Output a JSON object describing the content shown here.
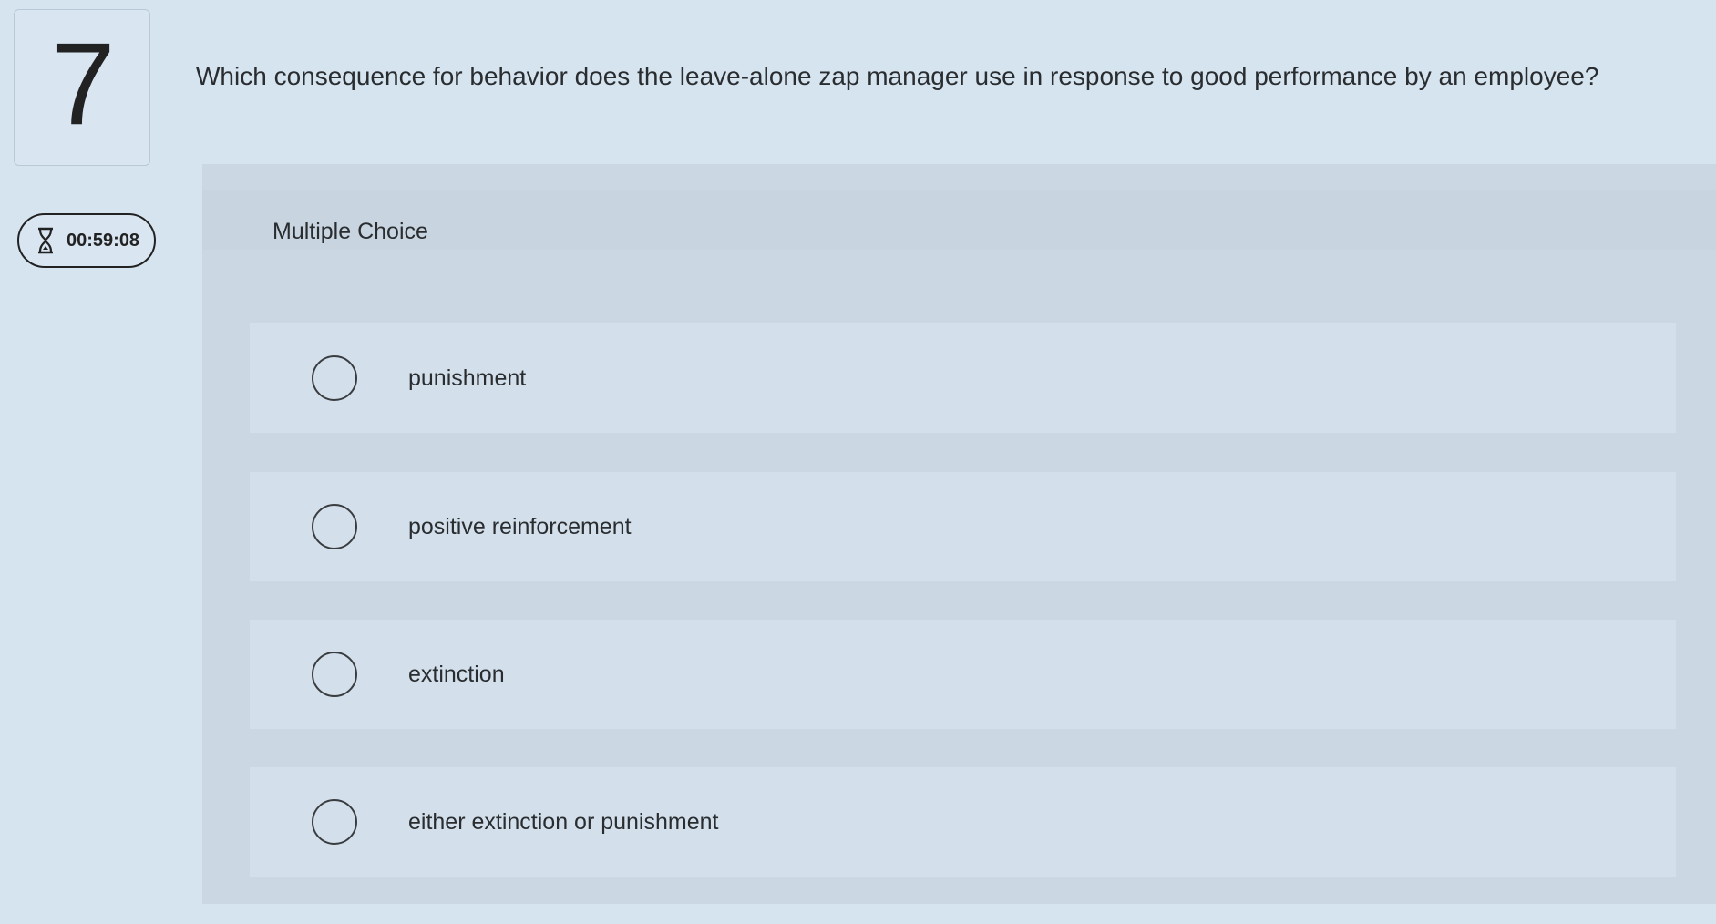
{
  "question": {
    "number": "7",
    "text": "Which consequence for behavior does the leave-alone zap manager use in response to good performance by an employee?"
  },
  "timer": {
    "icon": "hourglass-icon",
    "value": "00:59:08"
  },
  "panel": {
    "type_label": "Multiple Choice",
    "options": [
      {
        "label": "punishment"
      },
      {
        "label": "positive reinforcement"
      },
      {
        "label": "extinction"
      },
      {
        "label": "either extinction or punishment"
      }
    ]
  }
}
